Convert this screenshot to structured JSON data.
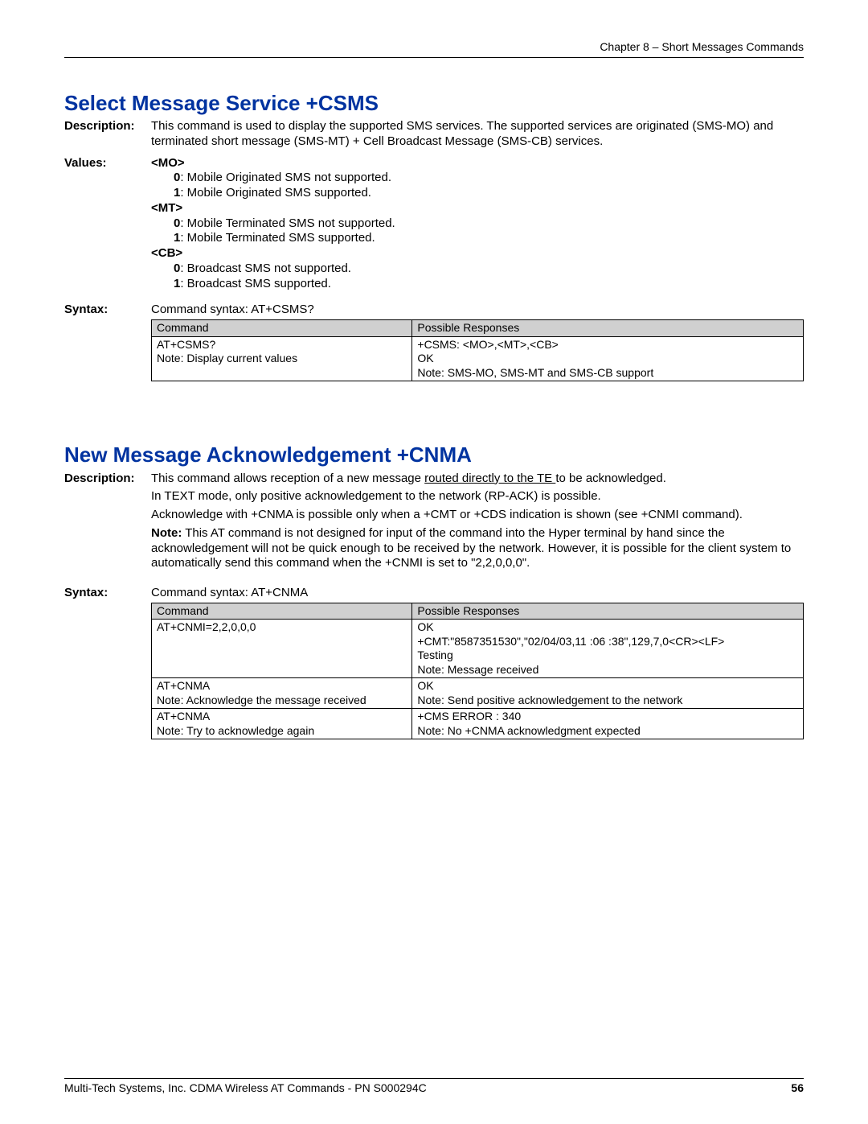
{
  "header": {
    "chapter": "Chapter 8 – Short Messages Commands"
  },
  "section1": {
    "title": "Select Message Service  +CSMS",
    "labels": {
      "description": "Description:",
      "values": "Values:",
      "syntax": "Syntax:"
    },
    "description": "This command is used to display the supported SMS services. The supported services are originated (SMS-MO) and terminated short message (SMS-MT) + Cell Broadcast Message (SMS-CB) services.",
    "values": {
      "mo_hdr": "<MO>",
      "mo_0_k": "0",
      "mo_0_t": ": Mobile Originated SMS not supported.",
      "mo_1_k": "1",
      "mo_1_t": ": Mobile Originated SMS supported.",
      "mt_hdr": "<MT>",
      "mt_0_k": "0",
      "mt_0_t": ": Mobile Terminated SMS not supported.",
      "mt_1_k": "1",
      "mt_1_t": ": Mobile Terminated SMS supported.",
      "cb_hdr": "<CB>",
      "cb_0_k": "0",
      "cb_0_t": ": Broadcast SMS not supported.",
      "cb_1_k": "1",
      "cb_1_t": ": Broadcast SMS supported."
    },
    "syntax_text": "Command syntax: AT+CSMS?",
    "table": {
      "h1": "Command",
      "h2": "Possible Responses",
      "r1c1a": "AT+CSMS?",
      "r1c1b": "Note: Display current values",
      "r1c2a": "+CSMS: <MO>,<MT>,<CB>",
      "r1c2b": "OK",
      "r1c2c": "Note: SMS-MO, SMS-MT and SMS-CB support"
    }
  },
  "section2": {
    "title": "New Message Acknowledgement  +CNMA",
    "labels": {
      "description": "Description:",
      "syntax": "Syntax:"
    },
    "desc_p1a": "This command allows reception of a new message ",
    "desc_p1_u": "routed directly to the TE ",
    "desc_p1b": "to be acknowledged.",
    "desc_p2": "In TEXT mode, only positive acknowledgement to the network (RP-ACK) is possible.",
    "desc_p3": "Acknowledge with +CNMA is possible only when a +CMT or +CDS indication is shown (see +CNMI command).",
    "note_label": "Note:",
    "note_text": " This AT command is not designed for input of the command into the Hyper terminal by hand since the acknowledgement will not be quick enough to be received by the network. However, it is possible for the client system to automatically send this command when the +CNMI is set to \"2,2,0,0,0\".",
    "syntax_text": "Command syntax: AT+CNMA",
    "table": {
      "h1": "Command",
      "h2": "Possible Responses",
      "r1c1": "AT+CNMI=2,2,0,0,0",
      "r1c2a": "OK",
      "r1c2b": "+CMT:\"8587351530\",\"02/04/03,11 :06 :38\",129,7,0<CR><LF>",
      "r1c2c": "Testing",
      "r1c2d": "Note: Message received",
      "r2c1a": "AT+CNMA",
      "r2c1b": "Note: Acknowledge the message received",
      "r2c2a": "OK",
      "r2c2b": "Note: Send positive acknowledgement to the network",
      "r3c1a": "AT+CNMA",
      "r3c1b": "Note: Try to acknowledge again",
      "r3c2a": "+CMS ERROR : 340",
      "r3c2b": "Note: No +CNMA acknowledgment expected"
    }
  },
  "footer": {
    "text": "Multi-Tech Systems, Inc. CDMA Wireless AT Commands - PN S000294C",
    "page": "56"
  }
}
